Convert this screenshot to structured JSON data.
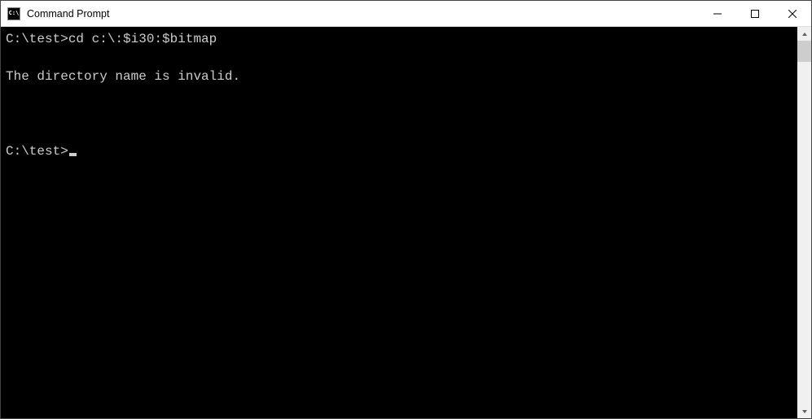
{
  "window": {
    "icon_label": "C:\\",
    "title": "Command Prompt"
  },
  "terminal": {
    "lines": [
      {
        "prompt": "C:\\test>",
        "command": "cd c:\\:$i30:$bitmap"
      },
      {
        "text": "The directory name is invalid."
      },
      {
        "text": ""
      },
      {
        "prompt": "C:\\test>",
        "cursor": true
      }
    ]
  },
  "colors": {
    "terminal_bg": "#000000",
    "terminal_fg": "#cccccc",
    "titlebar_bg": "#ffffff"
  }
}
